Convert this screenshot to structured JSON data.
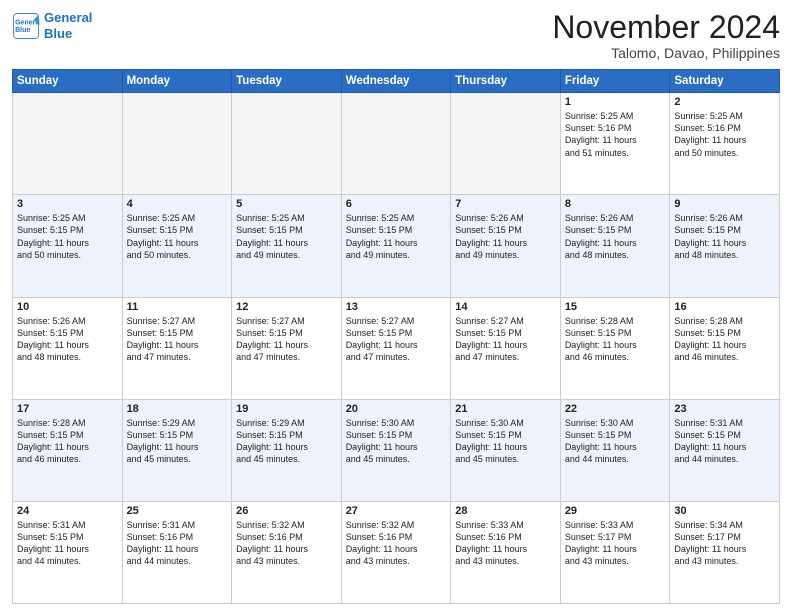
{
  "header": {
    "logo_line1": "General",
    "logo_line2": "Blue",
    "month": "November 2024",
    "location": "Talomo, Davao, Philippines"
  },
  "weekdays": [
    "Sunday",
    "Monday",
    "Tuesday",
    "Wednesday",
    "Thursday",
    "Friday",
    "Saturday"
  ],
  "weeks": [
    [
      {
        "day": "",
        "info": ""
      },
      {
        "day": "",
        "info": ""
      },
      {
        "day": "",
        "info": ""
      },
      {
        "day": "",
        "info": ""
      },
      {
        "day": "",
        "info": ""
      },
      {
        "day": "1",
        "info": "Sunrise: 5:25 AM\nSunset: 5:16 PM\nDaylight: 11 hours\nand 51 minutes."
      },
      {
        "day": "2",
        "info": "Sunrise: 5:25 AM\nSunset: 5:16 PM\nDaylight: 11 hours\nand 50 minutes."
      }
    ],
    [
      {
        "day": "3",
        "info": "Sunrise: 5:25 AM\nSunset: 5:15 PM\nDaylight: 11 hours\nand 50 minutes."
      },
      {
        "day": "4",
        "info": "Sunrise: 5:25 AM\nSunset: 5:15 PM\nDaylight: 11 hours\nand 50 minutes."
      },
      {
        "day": "5",
        "info": "Sunrise: 5:25 AM\nSunset: 5:15 PM\nDaylight: 11 hours\nand 49 minutes."
      },
      {
        "day": "6",
        "info": "Sunrise: 5:25 AM\nSunset: 5:15 PM\nDaylight: 11 hours\nand 49 minutes."
      },
      {
        "day": "7",
        "info": "Sunrise: 5:26 AM\nSunset: 5:15 PM\nDaylight: 11 hours\nand 49 minutes."
      },
      {
        "day": "8",
        "info": "Sunrise: 5:26 AM\nSunset: 5:15 PM\nDaylight: 11 hours\nand 48 minutes."
      },
      {
        "day": "9",
        "info": "Sunrise: 5:26 AM\nSunset: 5:15 PM\nDaylight: 11 hours\nand 48 minutes."
      }
    ],
    [
      {
        "day": "10",
        "info": "Sunrise: 5:26 AM\nSunset: 5:15 PM\nDaylight: 11 hours\nand 48 minutes."
      },
      {
        "day": "11",
        "info": "Sunrise: 5:27 AM\nSunset: 5:15 PM\nDaylight: 11 hours\nand 47 minutes."
      },
      {
        "day": "12",
        "info": "Sunrise: 5:27 AM\nSunset: 5:15 PM\nDaylight: 11 hours\nand 47 minutes."
      },
      {
        "day": "13",
        "info": "Sunrise: 5:27 AM\nSunset: 5:15 PM\nDaylight: 11 hours\nand 47 minutes."
      },
      {
        "day": "14",
        "info": "Sunrise: 5:27 AM\nSunset: 5:15 PM\nDaylight: 11 hours\nand 47 minutes."
      },
      {
        "day": "15",
        "info": "Sunrise: 5:28 AM\nSunset: 5:15 PM\nDaylight: 11 hours\nand 46 minutes."
      },
      {
        "day": "16",
        "info": "Sunrise: 5:28 AM\nSunset: 5:15 PM\nDaylight: 11 hours\nand 46 minutes."
      }
    ],
    [
      {
        "day": "17",
        "info": "Sunrise: 5:28 AM\nSunset: 5:15 PM\nDaylight: 11 hours\nand 46 minutes."
      },
      {
        "day": "18",
        "info": "Sunrise: 5:29 AM\nSunset: 5:15 PM\nDaylight: 11 hours\nand 45 minutes."
      },
      {
        "day": "19",
        "info": "Sunrise: 5:29 AM\nSunset: 5:15 PM\nDaylight: 11 hours\nand 45 minutes."
      },
      {
        "day": "20",
        "info": "Sunrise: 5:30 AM\nSunset: 5:15 PM\nDaylight: 11 hours\nand 45 minutes."
      },
      {
        "day": "21",
        "info": "Sunrise: 5:30 AM\nSunset: 5:15 PM\nDaylight: 11 hours\nand 45 minutes."
      },
      {
        "day": "22",
        "info": "Sunrise: 5:30 AM\nSunset: 5:15 PM\nDaylight: 11 hours\nand 44 minutes."
      },
      {
        "day": "23",
        "info": "Sunrise: 5:31 AM\nSunset: 5:15 PM\nDaylight: 11 hours\nand 44 minutes."
      }
    ],
    [
      {
        "day": "24",
        "info": "Sunrise: 5:31 AM\nSunset: 5:15 PM\nDaylight: 11 hours\nand 44 minutes."
      },
      {
        "day": "25",
        "info": "Sunrise: 5:31 AM\nSunset: 5:16 PM\nDaylight: 11 hours\nand 44 minutes."
      },
      {
        "day": "26",
        "info": "Sunrise: 5:32 AM\nSunset: 5:16 PM\nDaylight: 11 hours\nand 43 minutes."
      },
      {
        "day": "27",
        "info": "Sunrise: 5:32 AM\nSunset: 5:16 PM\nDaylight: 11 hours\nand 43 minutes."
      },
      {
        "day": "28",
        "info": "Sunrise: 5:33 AM\nSunset: 5:16 PM\nDaylight: 11 hours\nand 43 minutes."
      },
      {
        "day": "29",
        "info": "Sunrise: 5:33 AM\nSunset: 5:17 PM\nDaylight: 11 hours\nand 43 minutes."
      },
      {
        "day": "30",
        "info": "Sunrise: 5:34 AM\nSunset: 5:17 PM\nDaylight: 11 hours\nand 43 minutes."
      }
    ]
  ]
}
